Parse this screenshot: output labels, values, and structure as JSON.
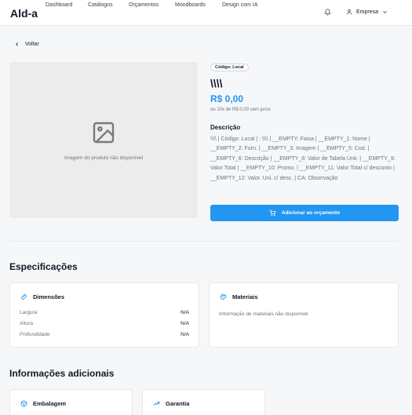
{
  "header": {
    "logo": "Ald-a",
    "nav": [
      {
        "label": "Dashboard"
      },
      {
        "label": "Catálogos"
      },
      {
        "label": "Orçamentos"
      },
      {
        "label": "Moodboards"
      },
      {
        "label": "Design com IA"
      }
    ],
    "bell_icon": "bell-icon",
    "company_label": "Empresa",
    "user_icon": "user-icon",
    "chevron_icon": "chevron-down-icon"
  },
  "back": {
    "label": "Voltar",
    "icon": "chevron-left-icon"
  },
  "product": {
    "image_placeholder": "Imagem do produto não disponível",
    "code_badge": "Código: Local",
    "title": "\\\\\\\\",
    "price": "R$ 0,00",
    "installments": "ou 10x de R$ 0,00 sem juros",
    "description_label": "Descrição",
    "description": "\\\\\\\\ | Código: Local | : \\\\\\\\ | __EMPTY: Faixa | __EMPTY_1: Nome | __EMPTY_2: Forn. | __EMPTY_3: Imagem | __EMPTY_5: Cod. | __EMPTY_6: Descrição | __EMPTY_8: Valor de Tabela Unit. | __EMPTY_9: Valor Total | __EMPTY_10: Promo. | __EMPTY_11: Valor Total c/ desconto | __EMPTY_12: Valor. Uni. c/ desc. | CA: Observação",
    "add_button": "Adicionar ao orçamento"
  },
  "specs": {
    "title": "Especificações",
    "dimensions": {
      "title": "Dimensões",
      "rows": [
        {
          "label": "Largura",
          "value": "N/A"
        },
        {
          "label": "Altura",
          "value": "N/A"
        },
        {
          "label": "Profundidade",
          "value": "N/A"
        }
      ]
    },
    "materials": {
      "title": "Materiais",
      "note": "Informação de materiais não disponível"
    }
  },
  "additional": {
    "title": "Informações adicionais",
    "packaging": {
      "title": "Embalagem"
    },
    "warranty": {
      "title": "Garantia"
    }
  },
  "colors": {
    "accent": "#2196f3",
    "background": "#f6f7f9",
    "card": "#ffffff",
    "muted": "#6b7280"
  }
}
